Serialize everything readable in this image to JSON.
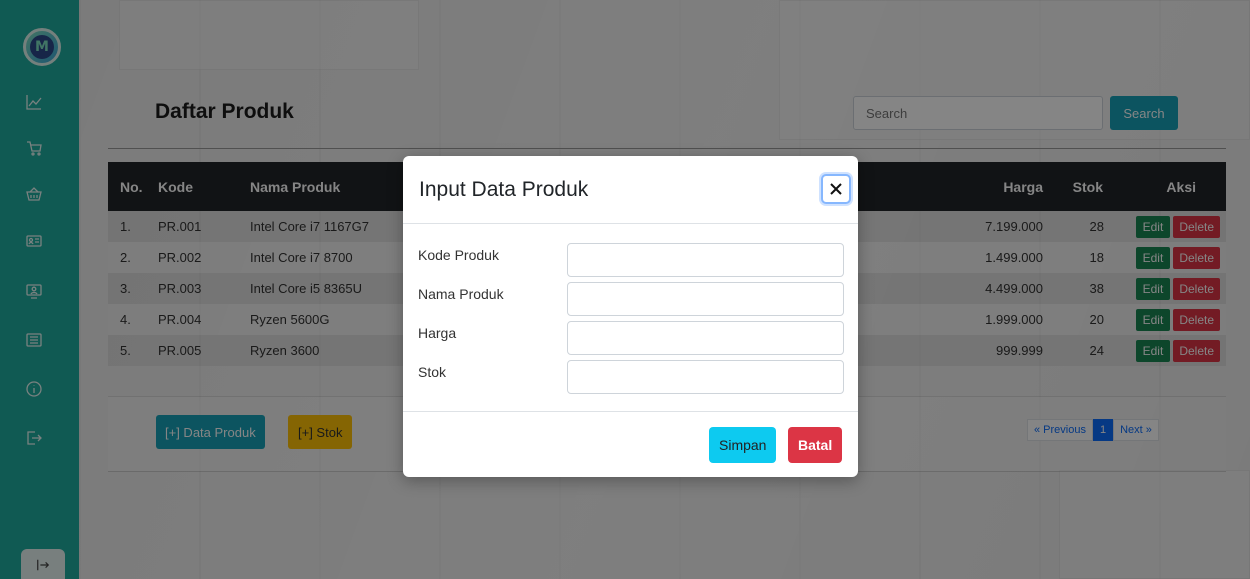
{
  "app": {
    "logo_letter": "M"
  },
  "sidebar": {
    "icons": [
      "chart-line-icon",
      "cart-icon",
      "basket-icon",
      "id-card-icon",
      "monitor-user-icon",
      "list-icon",
      "info-icon",
      "export-icon"
    ],
    "logout_icon": "logout-icon"
  },
  "page": {
    "title": "Daftar Produk"
  },
  "search": {
    "placeholder": "Search",
    "button_label": "Search"
  },
  "table": {
    "headers": {
      "no": "No.",
      "kode": "Kode",
      "nama": "Nama Produk",
      "harga": "Harga",
      "stok": "Stok",
      "aksi": "Aksi"
    },
    "rows": [
      {
        "no": "1.",
        "kode": "PR.001",
        "nama": "Intel Core i7 1167G7",
        "harga": "7.199.000",
        "stok": "28"
      },
      {
        "no": "2.",
        "kode": "PR.002",
        "nama": "Intel Core i7 8700",
        "harga": "1.499.000",
        "stok": "18"
      },
      {
        "no": "3.",
        "kode": "PR.003",
        "nama": "Intel Core i5 8365U",
        "harga": "4.499.000",
        "stok": "38"
      },
      {
        "no": "4.",
        "kode": "PR.004",
        "nama": "Ryzen 5600G",
        "harga": "1.999.000",
        "stok": "20"
      },
      {
        "no": "5.",
        "kode": "PR.005",
        "nama": "Ryzen 3600",
        "harga": "999.999",
        "stok": "24"
      }
    ],
    "edit_label": "Edit",
    "delete_label": "Delete"
  },
  "footer": {
    "add_product_label": "[+] Data Produk",
    "add_stock_label": "[+] Stok",
    "pagination": {
      "prev": "« Previous",
      "current": "1",
      "next": "Next »"
    }
  },
  "modal": {
    "title": "Input Data Produk",
    "fields": [
      {
        "label": "Kode Produk",
        "value": ""
      },
      {
        "label": "Nama Produk",
        "value": ""
      },
      {
        "label": "Harga",
        "value": ""
      },
      {
        "label": "Stok",
        "value": ""
      }
    ],
    "save_label": "Simpan",
    "cancel_label": "Batal"
  },
  "colors": {
    "sidebar": "#1fad9f",
    "info": "#17a2b8",
    "warning": "#ffc107",
    "success": "#198754",
    "danger": "#dc3545",
    "primary": "#0d6efd"
  }
}
